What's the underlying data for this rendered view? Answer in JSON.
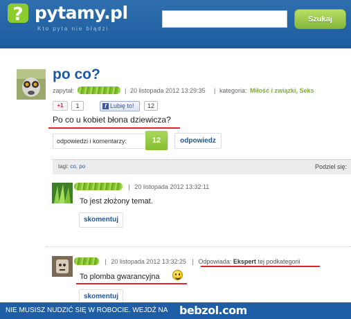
{
  "header": {
    "logo_text": "pytamy.pl",
    "slogan": "Kto pyta nie błądzi",
    "search_placeholder": "",
    "search_button": "Szukaj"
  },
  "question": {
    "title": "po co?",
    "asked_label": "zapytał:",
    "date": "20 listopada 2012 13:29:35",
    "separator": "|",
    "category_label": "kategoria:",
    "category_value": "Miłość i związki, Seks",
    "gplus_label": "+1",
    "gplus_count": "1",
    "like_label": "Lubię to!",
    "like_count": "12",
    "body": "Po co u kobiet błona dziewicza?",
    "answers_label": "odpowiedzi i komentarzy:",
    "answers_count": "12",
    "answer_button": "odpowiedz",
    "tags_label": "tagi:",
    "tags": "co, po",
    "share_label": "Podziel się:"
  },
  "answers": [
    {
      "date": "20 listopada 2012 13:32:11",
      "body": "To jest złożony temat.",
      "comment_button": "skomentuj"
    },
    {
      "date": "20 listopada 2012 13:32:25",
      "expert_prefix": "Odpowiada:",
      "expert_name": "Ekspert",
      "expert_suffix": "tej podkategorii",
      "body": "To plomba gwarancyjna",
      "comment_button": "skomentuj"
    }
  ],
  "banner": {
    "text": "NIE MUSISZ NUDZIĆ SIĘ W ROBOCIE. WEJDŹ NA",
    "brand": "bebzol.com"
  },
  "colors": {
    "header_blue": "#1b5c9f",
    "accent_green": "#86bf30",
    "link_blue": "#1c58a3",
    "highlight_red": "#e1242a"
  }
}
